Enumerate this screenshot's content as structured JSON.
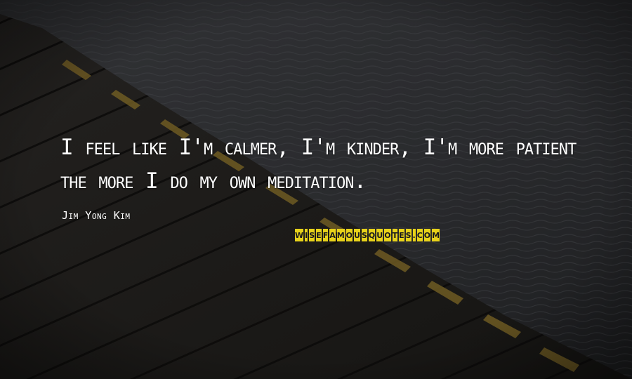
{
  "quote": {
    "text": "I feel like I'm calmer, I'm kinder, I'm more patient the more I do my own meditation.",
    "author": "Jim Yong Kim"
  },
  "watermark": {
    "text": "WISEFAMOUSQUOTES.COM",
    "color": "#e8d21a"
  },
  "colors": {
    "text": "#ffffff",
    "water": "#2a2b2e",
    "dock_wood": "#1c1a17",
    "dock_edge": "#6e5b23"
  }
}
